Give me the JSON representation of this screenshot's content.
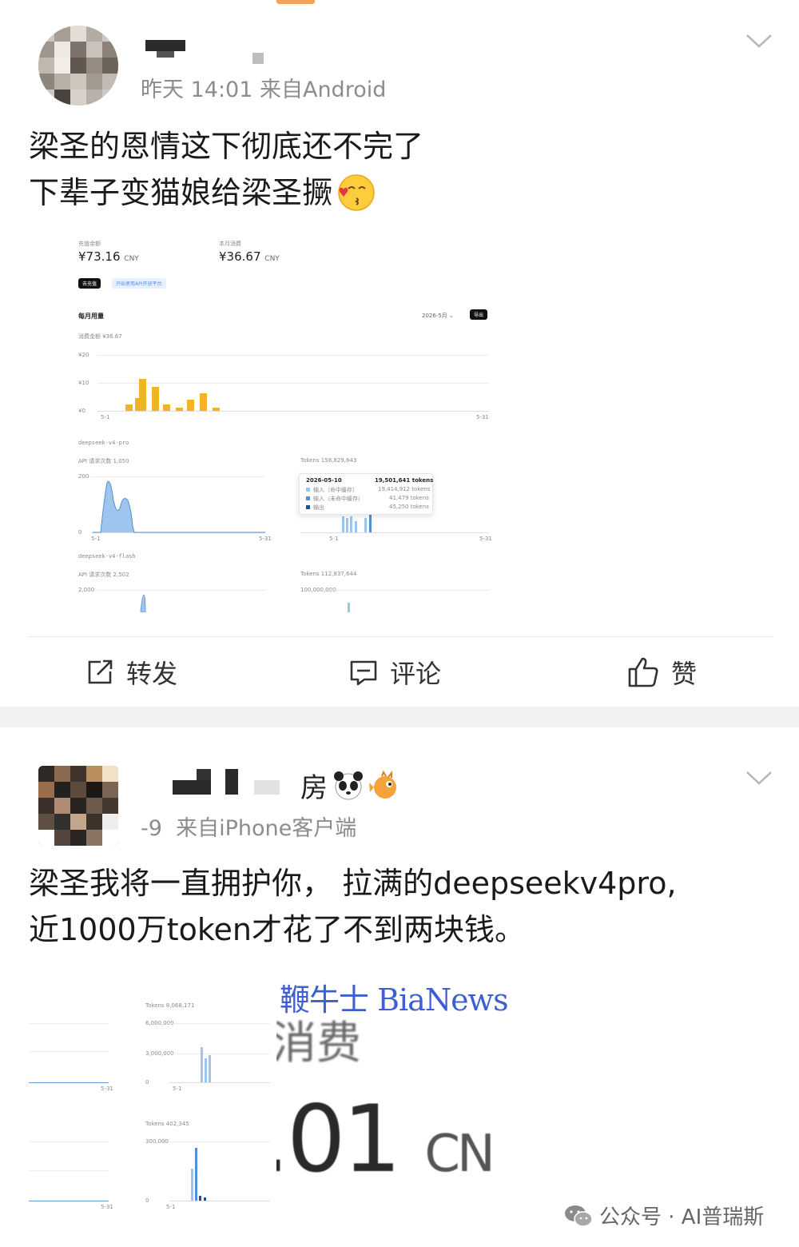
{
  "post1": {
    "meta": "昨天 14:01  来自Android",
    "text_line1": "梁圣的恩情这下彻底还不完了",
    "text_line2": "下辈子变猫娘给梁圣撅",
    "screenshot": {
      "balance_label": "充值余额",
      "balance_value": "¥73.16",
      "balance_unit": "CNY",
      "month_label": "本月消费",
      "month_value": "¥36.67",
      "month_unit": "CNY",
      "tab_active": "去充值",
      "tab_secondary": "开始使用API开放平台",
      "section_title": "每月用量",
      "month_select": "2026-5月",
      "export_button": "导出",
      "spend_label": "消费金额  ¥36.67",
      "y_ticks": [
        "¥20",
        "¥10",
        "¥0"
      ],
      "x_start": "5-1",
      "x_end": "5-31",
      "model1": "deepseek-v4-pro",
      "model1_api": "API 请求次数  1,050",
      "model1_tokens": "Tokens  158,829,643",
      "model1_ytick_top": "200",
      "model1_ytick_zero": "0",
      "tooltip_date": "2026-05-10",
      "tooltip_total": "19,501,641 tokens",
      "tooltip_rows": [
        {
          "label": "输入（命中缓存）",
          "value": "19,414,912 tokens",
          "color": "#9ec5ee"
        },
        {
          "label": "输入（未命中缓存）",
          "value": "41,479 tokens",
          "color": "#4f90d6"
        },
        {
          "label": "输出",
          "value": "45,250 tokens",
          "color": "#1f4f99"
        }
      ],
      "model2": "deepseek-v4-flash",
      "model2_api": "API 请求次数  2,502",
      "model2_tokens": "Tokens  112,837,644",
      "model2_ytick_top": "2,000",
      "model2_tokens_tick": "100,000,000",
      "colors": {
        "bar": "#f0b429",
        "area": "#9ec5ee",
        "area_stroke": "#4f90d6"
      }
    }
  },
  "actions": {
    "repost": "转发",
    "comment": "评论",
    "like": "赞"
  },
  "post2": {
    "name_suffix": "房",
    "meta_date": "-9",
    "meta_source": "来自iPhone客户端",
    "text_line1": "梁圣我将一直拥护你， 拉满的deepseekv4pro,",
    "text_line2": "近1000万token才花了不到两块钱。",
    "screenshot": {
      "tokens_label_1": "Tokens  8,068,171",
      "ticks_1": [
        "6,000,000",
        "3,000,000",
        "0"
      ],
      "x_start": "5-1",
      "x_end": "5-31",
      "tokens_label_2": "Tokens  402,345",
      "ticks_2": [
        "300,000",
        "0"
      ],
      "big_label": "消费",
      "big_value": ".01",
      "big_unit": "CN"
    }
  },
  "watermark": "鞭牛士 BiaNews",
  "footer": "公众号 · AI普瑞斯"
}
